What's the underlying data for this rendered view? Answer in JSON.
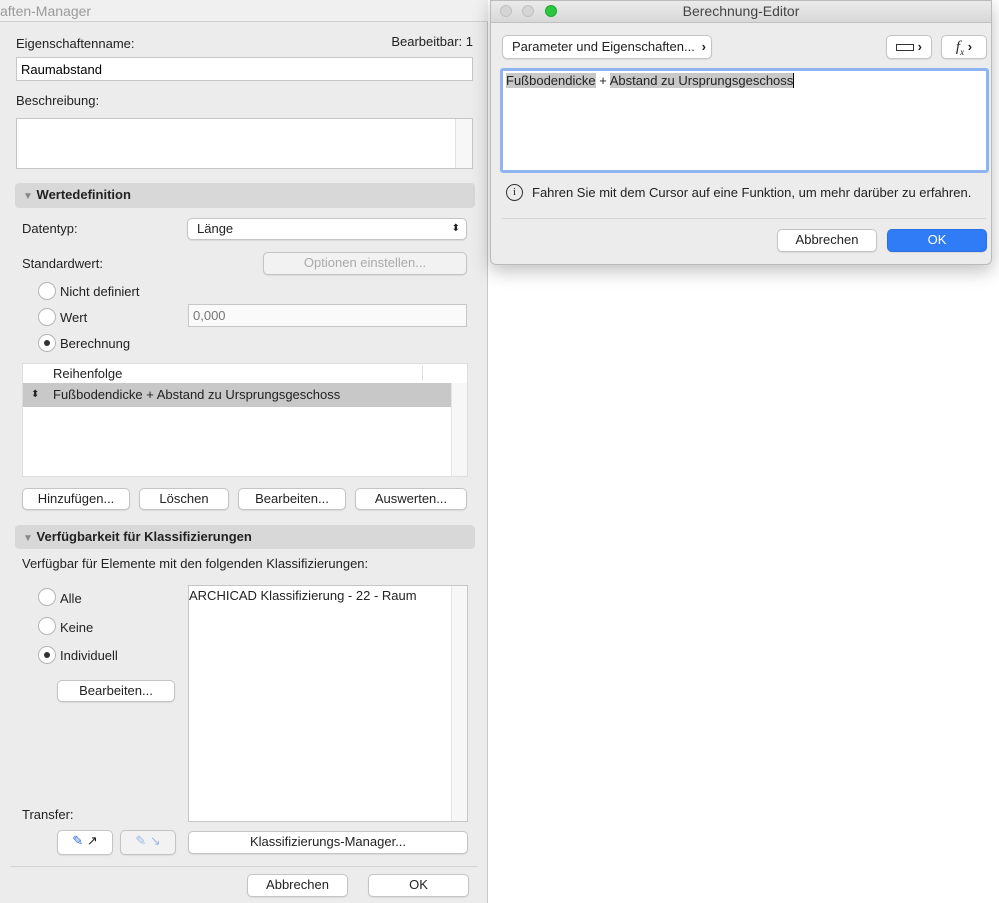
{
  "left": {
    "title": "aften-Manager",
    "name_label": "Eigenschaftenname:",
    "editable": "Bearbeitbar: 1",
    "name_value": "Raumabstand",
    "desc_label": "Beschreibung:",
    "section_values": "Wertedefinition",
    "datatype_label": "Datentyp:",
    "datatype_value": "Länge",
    "default_label": "Standardwert:",
    "options_button": "Optionen einstellen...",
    "radio_undefined": "Nicht definiert",
    "radio_value": "Wert",
    "value_placeholder": "0,000",
    "radio_calc": "Berechnung",
    "order_header": "Reihenfolge",
    "order_rows": [
      "Fußbodendicke + Abstand zu Ursprungsgeschoss"
    ],
    "btn_add": "Hinzufügen...",
    "btn_delete": "Löschen",
    "btn_edit": "Bearbeiten...",
    "btn_eval": "Auswerten...",
    "section_avail": "Verfügbarkeit für Klassifizierungen",
    "avail_desc": "Verfügbar für Elemente mit den folgenden Klassifizierungen:",
    "radio_all": "Alle",
    "radio_none": "Keine",
    "radio_individual": "Individuell",
    "btn_edit2": "Bearbeiten...",
    "class_list": [
      "ARCHICAD Klassifizierung - 22 - Raum"
    ],
    "transfer_label": "Transfer:",
    "btn_class_manager": "Klassifizierungs-Manager...",
    "btn_cancel": "Abbrechen",
    "btn_ok": "OK"
  },
  "dialog": {
    "title": "Berechnung-Editor",
    "params_button": "Parameter und Eigenschaften...",
    "formula_part1": "Fußbodendicke",
    "formula_op": " + ",
    "formula_part2": "Abstand zu Ursprungsgeschoss",
    "info": "Fahren Sie mit dem Cursor auf eine Funktion, um mehr darüber zu erfahren.",
    "btn_cancel": "Abbrechen",
    "btn_ok": "OK",
    "accent": "#2f7cf6"
  }
}
